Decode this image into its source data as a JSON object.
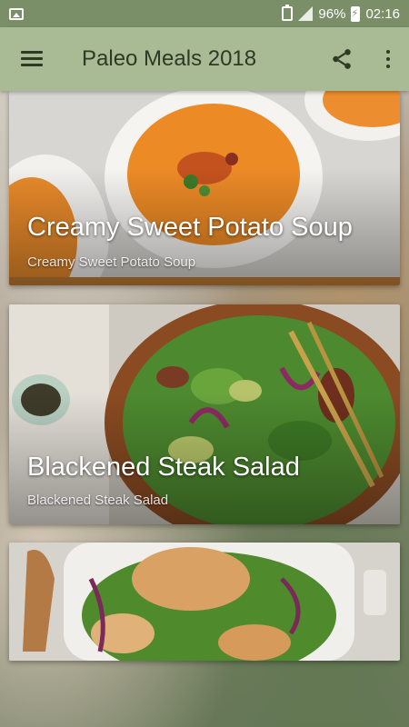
{
  "status_bar": {
    "battery_percent": "96%",
    "time": "02:16",
    "icons": [
      "picture-icon",
      "battery-saver-icon",
      "signal-icon",
      "battery-charging-icon"
    ]
  },
  "app_bar": {
    "title": "Paleo Meals 2018",
    "icons": [
      "menu-icon",
      "share-icon",
      "more-vert-icon"
    ],
    "color": "#a8bb94"
  },
  "recipes": [
    {
      "title": "Creamy Sweet Potato Soup",
      "subtitle": "Creamy Sweet Potato Soup"
    },
    {
      "title": "Blackened Steak Salad",
      "subtitle": "Blackened Steak Salad"
    },
    {
      "title": "",
      "subtitle": ""
    }
  ],
  "colors": {
    "status_bar": "#7a8f68",
    "app_bar": "#a8bb94",
    "title_text": "#2e3a24"
  }
}
